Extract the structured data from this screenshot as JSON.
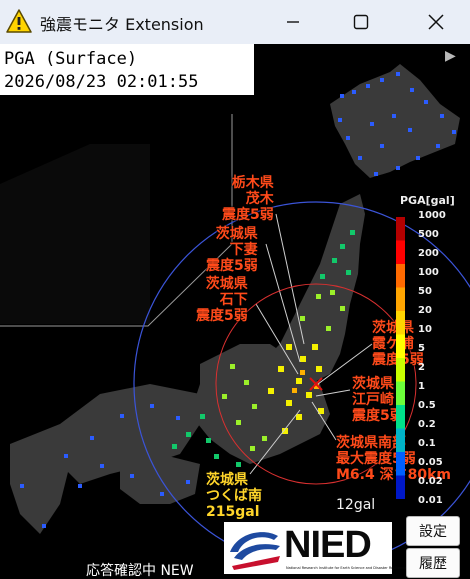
{
  "window": {
    "title": "強震モニタ Extension"
  },
  "info": {
    "line1": "PGA (Surface)",
    "line2": "2026/08/23 02:01:55"
  },
  "callouts": {
    "tochigi": [
      "栃木県",
      "茂木",
      "震度5弱"
    ],
    "ibaraki_shimotsuma": [
      "茨城県",
      "下妻",
      "震度5弱"
    ],
    "ibaraki_ishige": [
      "茨城県",
      "石下",
      "震度5弱"
    ],
    "ibaraki_kasumigaura": [
      "茨城県",
      "霞ケ浦",
      "震度5弱"
    ],
    "ibaraki_edosaki": [
      "茨城県",
      "江戸崎",
      "震度5弱"
    ],
    "epicenter": [
      "茨城県南部",
      "最大震度5弱",
      "M6.4 深さ80km"
    ],
    "tsukuba": [
      "茨城県",
      "つくば南",
      "215gal"
    ]
  },
  "legend": {
    "title": "PGA[gal]",
    "ticks": [
      "1000",
      "500",
      "200",
      "100",
      "50",
      "20",
      "10",
      "5",
      "2",
      "1",
      "0.5",
      "0.2",
      "0.1",
      "0.05",
      "0.02",
      "0.01"
    ],
    "colors": [
      "#b40000",
      "#ff0000",
      "#ff6a00",
      "#ffa500",
      "#ffd400",
      "#ffff00",
      "#c8ff00",
      "#6cff3a",
      "#00e08a",
      "#00b4c8",
      "#0060ff",
      "#0018c8"
    ]
  },
  "gal_value": "12gal",
  "status": "応答確認中 NEW",
  "logo": {
    "text": "NIED",
    "subtitle": "National Research Institute for Earth Science and Disaster Resilience"
  },
  "buttons": {
    "settings": "設定",
    "history": "履歴"
  }
}
